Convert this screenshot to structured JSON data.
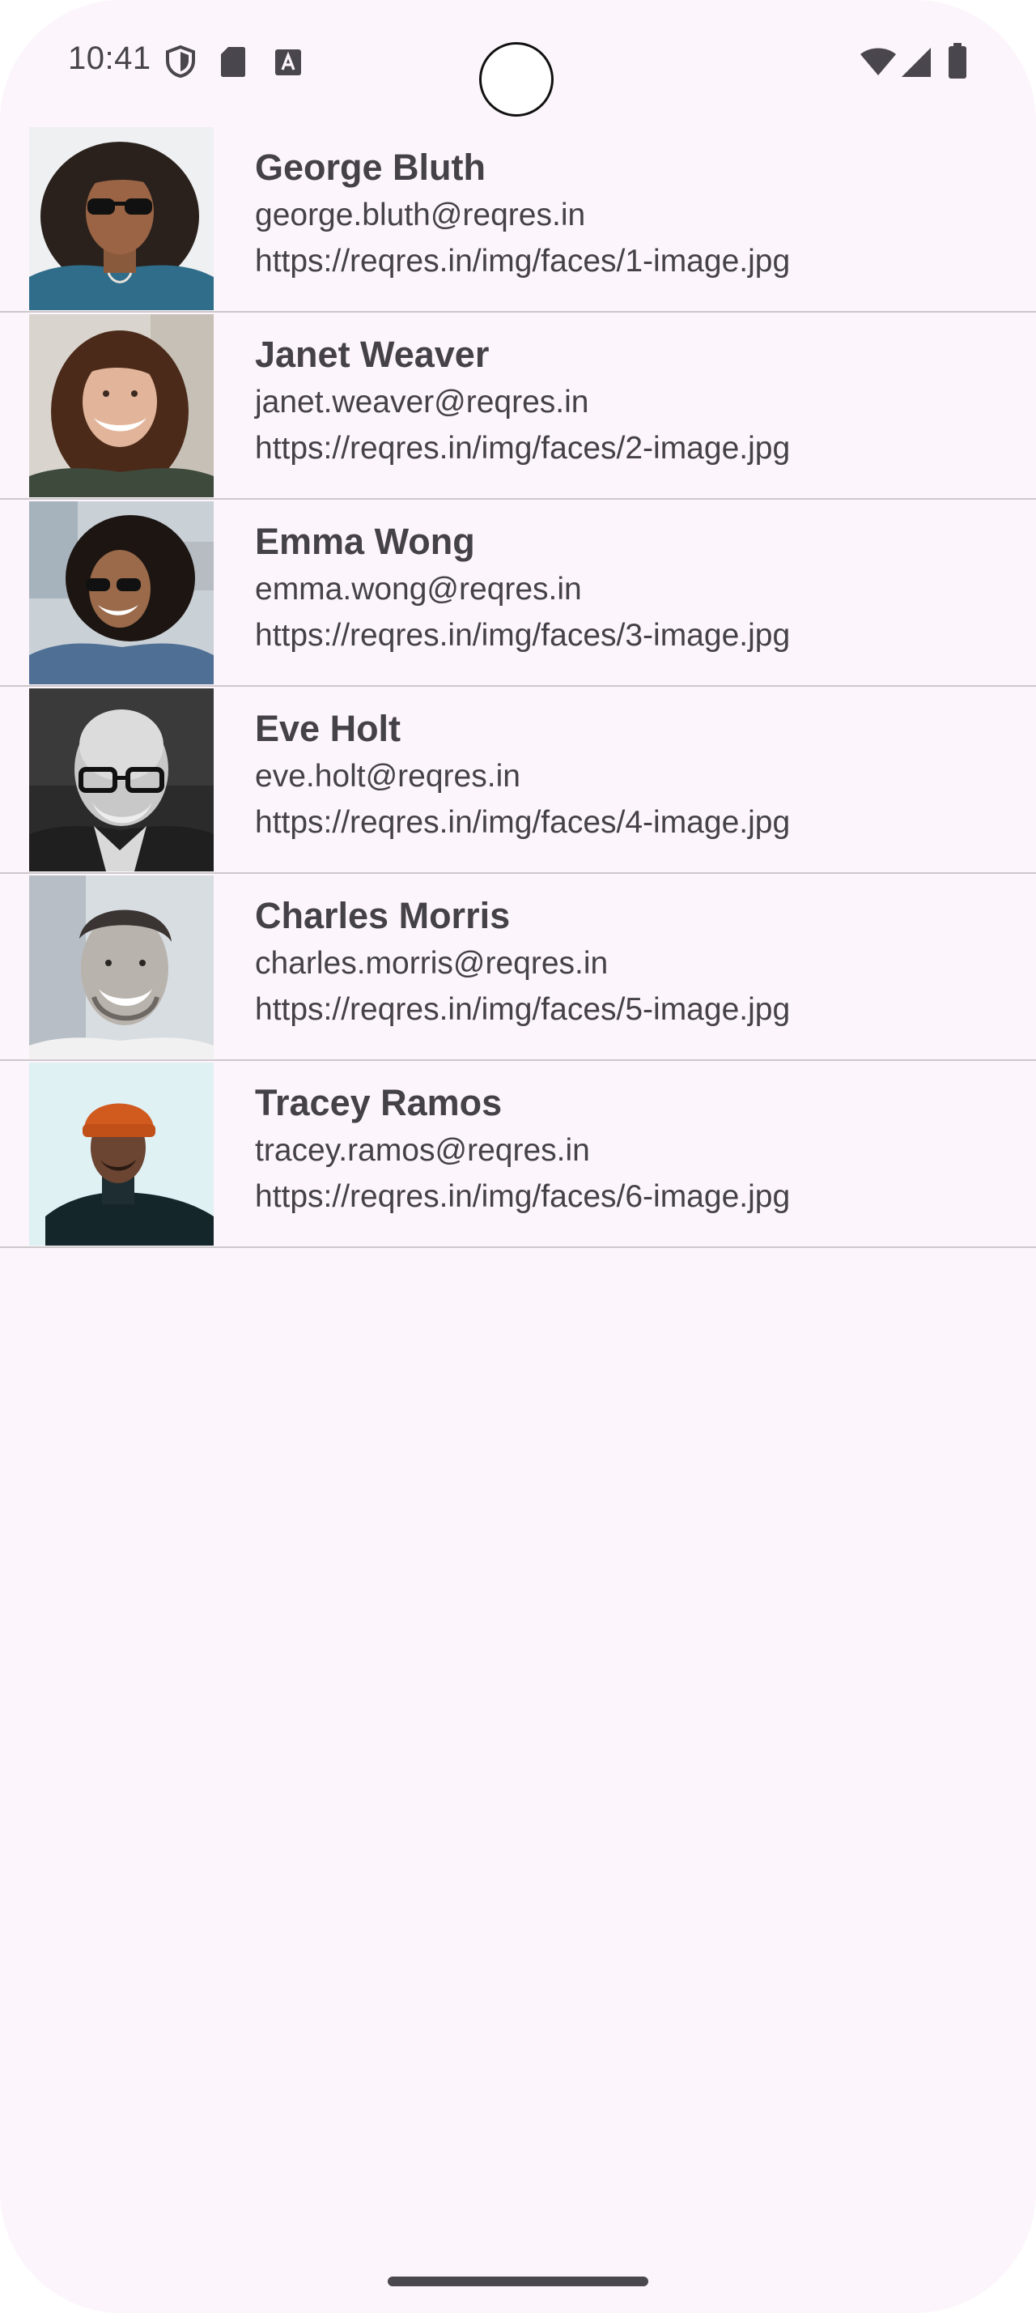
{
  "status_bar": {
    "time": "10:41",
    "left_icons": [
      "shield-icon",
      "sd-card-icon",
      "font-badge-icon"
    ],
    "right_icons": [
      "wifi-icon",
      "cellular-signal-icon",
      "battery-icon"
    ]
  },
  "users": [
    {
      "name": "George Bluth",
      "email": "george.bluth@reqres.in",
      "avatar_url": "https://reqres.in/img/faces/1-image.jpg"
    },
    {
      "name": "Janet Weaver",
      "email": "janet.weaver@reqres.in",
      "avatar_url": "https://reqres.in/img/faces/2-image.jpg"
    },
    {
      "name": "Emma Wong",
      "email": "emma.wong@reqres.in",
      "avatar_url": "https://reqres.in/img/faces/3-image.jpg"
    },
    {
      "name": "Eve Holt",
      "email": "eve.holt@reqres.in",
      "avatar_url": "https://reqres.in/img/faces/4-image.jpg"
    },
    {
      "name": "Charles Morris",
      "email": "charles.morris@reqres.in",
      "avatar_url": "https://reqres.in/img/faces/5-image.jpg"
    },
    {
      "name": "Tracey Ramos",
      "email": "tracey.ramos@reqres.in",
      "avatar_url": "https://reqres.in/img/faces/6-image.jpg"
    }
  ],
  "colors": {
    "background": "#fcf5fb",
    "text": "#454148",
    "divider": "#cdc8cc"
  }
}
